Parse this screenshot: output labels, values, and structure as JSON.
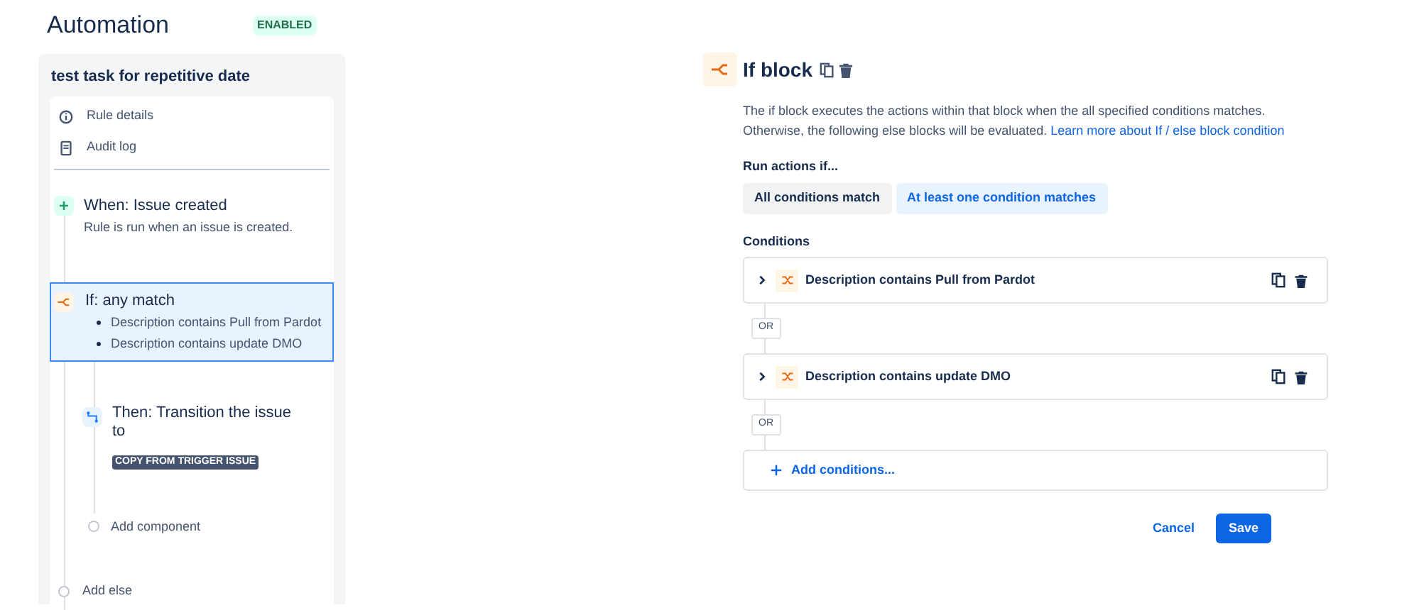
{
  "header": {
    "title": "Automation",
    "status": "ENABLED"
  },
  "sidebar": {
    "rule_name": "test task for repetitive date",
    "menu": [
      {
        "kind": "info",
        "label": "Rule details"
      },
      {
        "kind": "log",
        "label": "Audit log"
      }
    ],
    "trigger": {
      "title": "When: Issue created",
      "subtitle": "Rule is run when an issue is created."
    },
    "if_block": {
      "title": "If: any match",
      "selected": true,
      "conditions": [
        "Description contains Pull from Pardot",
        "Description contains update DMO"
      ]
    },
    "action": {
      "title": "Then: Transition the issue",
      "line_2": "to",
      "tag": "COPY FROM TRIGGER ISSUE"
    },
    "add_component": "Add component",
    "add_else": "Add else"
  },
  "panel": {
    "title": "If block",
    "description": "The if block executes the actions within that block when the all specified conditions matches. Otherwise, the following else blocks will be evaluated.",
    "link": "Learn more about If / else block condition",
    "run_label": "Run actions if...",
    "options": [
      {
        "label": "All conditions match",
        "selected": false
      },
      {
        "label": "At least one condition matches",
        "selected": true
      }
    ],
    "conditions_label": "Conditions",
    "conditions": [
      {
        "label": "Description contains Pull from Pardot",
        "connector": "OR"
      },
      {
        "label": "Description contains update DMO",
        "connector": "OR"
      }
    ],
    "add_conditions": "Add conditions...",
    "buttons": [
      {
        "kind": "link",
        "label": "Cancel"
      },
      {
        "kind": "primary",
        "label": "Save"
      }
    ]
  }
}
